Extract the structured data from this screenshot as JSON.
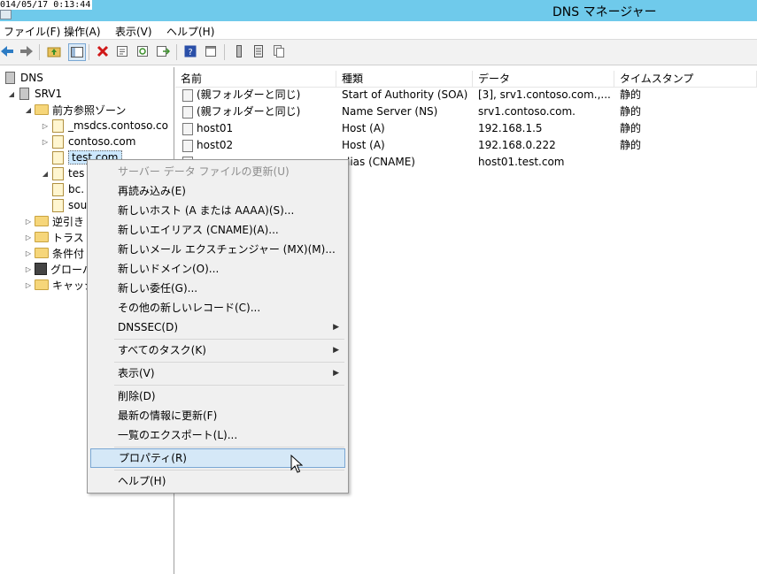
{
  "overlay": {
    "timestamp": "014/05/17 0:13:44"
  },
  "window": {
    "title": "DNS マネージャー"
  },
  "menubar": {
    "items": [
      "ファイル(F)",
      "操作(A)",
      "表示(V)",
      "ヘルプ(H)"
    ]
  },
  "toolbar": {
    "icons": [
      "back-arrow-icon",
      "forward-arrow-icon",
      "up-folder-icon",
      "show-hide-console-tree-icon",
      "delete-icon",
      "properties-icon",
      "refresh-icon",
      "export-list-icon",
      "help-icon",
      "console-icon",
      "server-icon",
      "list-icon",
      "copy-icon"
    ]
  },
  "tree": {
    "root": "DNS",
    "server": "SRV1",
    "forward_zones": "前方参照ゾーン",
    "zone_msdcs": "_msdcs.contoso.co",
    "zone_contoso": "contoso.com",
    "zone_test": "test.com",
    "zone_te": "tes",
    "sub_bc": "bc.",
    "sub_sou": "sou",
    "reverse": "逆引き",
    "trust": "トラスト",
    "conditional": "条件付",
    "global": "グローバ",
    "cache": "キャッシ"
  },
  "list": {
    "columns": [
      "名前",
      "種類",
      "データ",
      "タイムスタンプ"
    ],
    "rows": [
      {
        "name": "(親フォルダーと同じ)",
        "type": "Start of Authority (SOA)",
        "data": "[3], srv1.contoso.com.,...",
        "ts": "静的"
      },
      {
        "name": "(親フォルダーと同じ)",
        "type": "Name Server (NS)",
        "data": "srv1.contoso.com.",
        "ts": "静的"
      },
      {
        "name": "host01",
        "type": "Host (A)",
        "data": "192.168.1.5",
        "ts": "静的"
      },
      {
        "name": "host02",
        "type": "Host (A)",
        "data": "192.168.0.222",
        "ts": "静的"
      },
      {
        "name": "",
        "type": "lias (CNAME)",
        "data": "host01.test.com",
        "ts": ""
      }
    ]
  },
  "context_menu": {
    "update_server_file": "サーバー データ ファイルの更新(U)",
    "reload": "再読み込み(E)",
    "new_host": "新しいホスト (A または AAAA)(S)...",
    "new_alias": "新しいエイリアス (CNAME)(A)...",
    "new_mx": "新しいメール エクスチェンジャー (MX)(M)...",
    "new_domain": "新しいドメイン(O)...",
    "new_delegation": "新しい委任(G)...",
    "other_records": "その他の新しいレコード(C)...",
    "dnssec": "DNSSEC(D)",
    "all_tasks": "すべてのタスク(K)",
    "view": "表示(V)",
    "delete": "削除(D)",
    "refresh": "最新の情報に更新(F)",
    "export_list": "一覧のエクスポート(L)...",
    "properties": "プロパティ(R)",
    "help": "ヘルプ(H)"
  },
  "colors": {
    "titlebar": "#6fcaeb",
    "hover": "#d5e8f7",
    "hover_border": "#7aa7d3"
  }
}
